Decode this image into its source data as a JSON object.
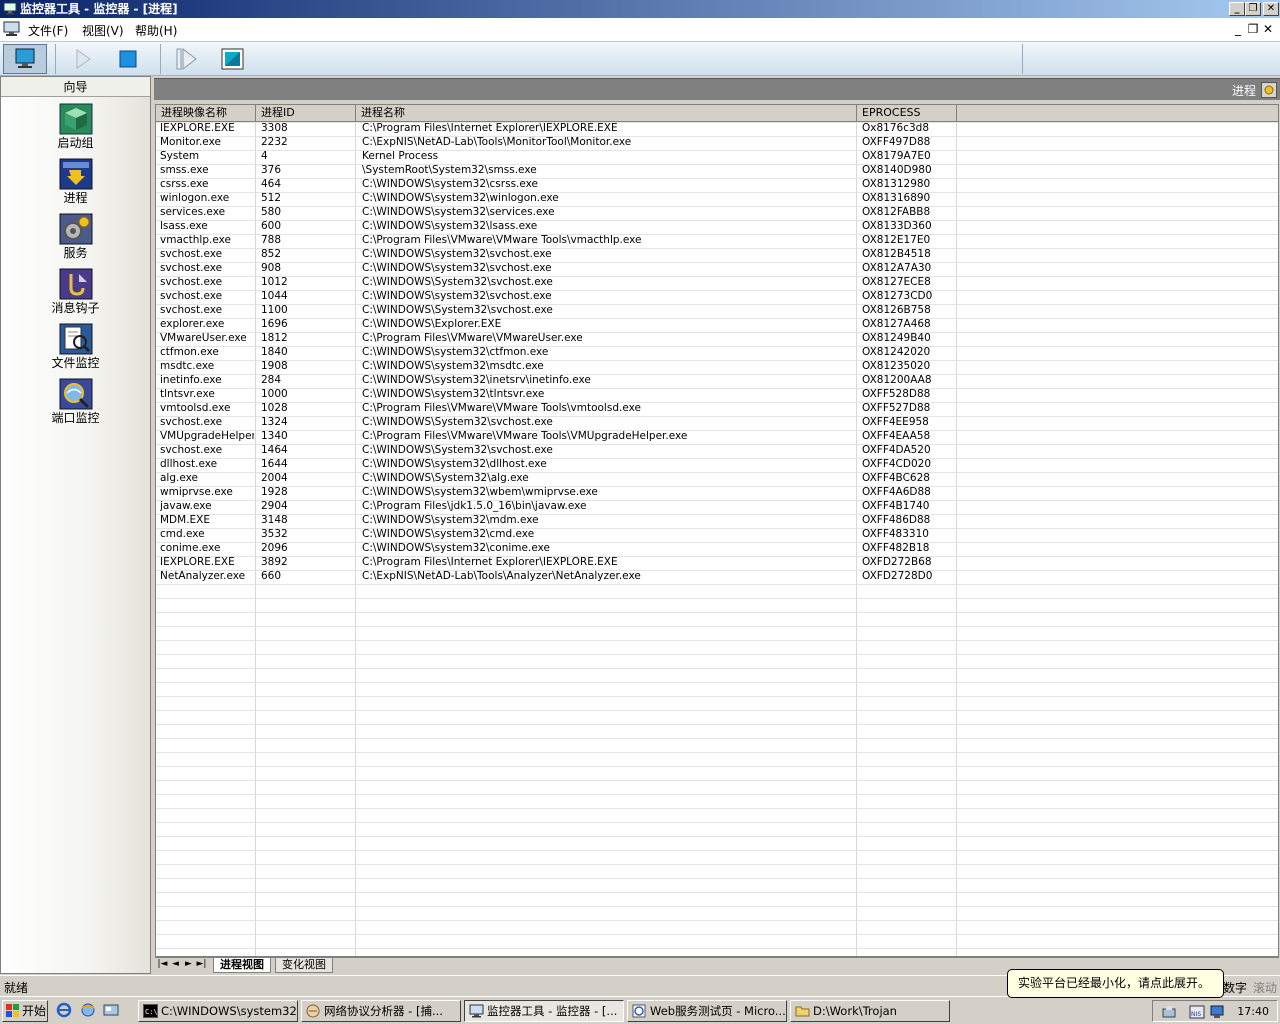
{
  "window": {
    "title": "监控器工具 - 监控器 - [进程]",
    "min": "_",
    "restore": "❐",
    "close": "✕"
  },
  "menu": {
    "items": [
      "文件(F)",
      "视图(V)",
      "帮助(H)"
    ],
    "mdi_min": "_",
    "mdi_restore": "❐",
    "mdi_close": "✕"
  },
  "sidebar": {
    "header": "向导",
    "items": [
      {
        "label": "启动组",
        "icon": "startup-group-icon"
      },
      {
        "label": "进程",
        "icon": "process-icon"
      },
      {
        "label": "服务",
        "icon": "services-icon"
      },
      {
        "label": "消息钩子",
        "icon": "message-hook-icon"
      },
      {
        "label": "文件监控",
        "icon": "file-monitor-icon"
      },
      {
        "label": "端口监控",
        "icon": "port-monitor-icon"
      }
    ]
  },
  "panel": {
    "title": "进程"
  },
  "table": {
    "columns": [
      "进程映像名称",
      "进程ID",
      "进程名称",
      "EPROCESS"
    ],
    "rows": [
      [
        "IEXPLORE.EXE",
        "3308",
        "C:\\Program Files\\Internet Explorer\\IEXPLORE.EXE",
        "Ox8176c3d8"
      ],
      [
        "Monitor.exe",
        "2232",
        "C:\\ExpNIS\\NetAD-Lab\\Tools\\MonitorTool\\Monitor.exe",
        "OXFF497D88"
      ],
      [
        "System",
        "4",
        "Kernel Process",
        "OX8179A7E0"
      ],
      [
        "smss.exe",
        "376",
        "\\SystemRoot\\System32\\smss.exe",
        "OX8140D980"
      ],
      [
        "csrss.exe",
        "464",
        "C:\\WINDOWS\\system32\\csrss.exe",
        "OX81312980"
      ],
      [
        "winlogon.exe",
        "512",
        "C:\\WINDOWS\\system32\\winlogon.exe",
        "OX81316890"
      ],
      [
        "services.exe",
        "580",
        "C:\\WINDOWS\\system32\\services.exe",
        "OX812FABB8"
      ],
      [
        "lsass.exe",
        "600",
        "C:\\WINDOWS\\system32\\lsass.exe",
        "OX8133D360"
      ],
      [
        "vmacthlp.exe",
        "788",
        "C:\\Program Files\\VMware\\VMware Tools\\vmacthlp.exe",
        "OX812E17E0"
      ],
      [
        "svchost.exe",
        "852",
        "C:\\WINDOWS\\system32\\svchost.exe",
        "OX812B4518"
      ],
      [
        "svchost.exe",
        "908",
        "C:\\WINDOWS\\system32\\svchost.exe",
        "OX812A7A30"
      ],
      [
        "svchost.exe",
        "1012",
        "C:\\WINDOWS\\System32\\svchost.exe",
        "OX8127ECE8"
      ],
      [
        "svchost.exe",
        "1044",
        "C:\\WINDOWS\\system32\\svchost.exe",
        "OX81273CD0"
      ],
      [
        "svchost.exe",
        "1100",
        "C:\\WINDOWS\\System32\\svchost.exe",
        "OX8126B758"
      ],
      [
        "explorer.exe",
        "1696",
        "C:\\WINDOWS\\Explorer.EXE",
        "OX8127A468"
      ],
      [
        "VMwareUser.exe",
        "1812",
        "C:\\Program Files\\VMware\\VMwareUser.exe",
        "OX81249B40"
      ],
      [
        "ctfmon.exe",
        "1840",
        "C:\\WINDOWS\\system32\\ctfmon.exe",
        "OX81242020"
      ],
      [
        "msdtc.exe",
        "1908",
        "C:\\WINDOWS\\system32\\msdtc.exe",
        "OX81235020"
      ],
      [
        "inetinfo.exe",
        "284",
        "C:\\WINDOWS\\system32\\inetsrv\\inetinfo.exe",
        "OX81200AA8"
      ],
      [
        "tlntsvr.exe",
        "1000",
        "C:\\WINDOWS\\system32\\tlntsvr.exe",
        "OXFF528D88"
      ],
      [
        "vmtoolsd.exe",
        "1028",
        "C:\\Program Files\\VMware\\VMware Tools\\vmtoolsd.exe",
        "OXFF527D88"
      ],
      [
        "svchost.exe",
        "1324",
        "C:\\WINDOWS\\System32\\svchost.exe",
        "OXFF4EE958"
      ],
      [
        "VMUpgradeHelper",
        "1340",
        "C:\\Program Files\\VMware\\VMware Tools\\VMUpgradeHelper.exe",
        "OXFF4EAA58"
      ],
      [
        "svchost.exe",
        "1464",
        "C:\\WINDOWS\\System32\\svchost.exe",
        "OXFF4DA520"
      ],
      [
        "dllhost.exe",
        "1644",
        "C:\\WINDOWS\\system32\\dllhost.exe",
        "OXFF4CD020"
      ],
      [
        "alg.exe",
        "2004",
        "C:\\WINDOWS\\System32\\alg.exe",
        "OXFF4BC628"
      ],
      [
        "wmiprvse.exe",
        "1928",
        "C:\\WINDOWS\\system32\\wbem\\wmiprvse.exe",
        "OXFF4A6D88"
      ],
      [
        "javaw.exe",
        "2904",
        "C:\\Program Files\\jdk1.5.0_16\\bin\\javaw.exe",
        "OXFF4B1740"
      ],
      [
        "MDM.EXE",
        "3148",
        "C:\\WINDOWS\\system32\\mdm.exe",
        "OXFF486D88"
      ],
      [
        "cmd.exe",
        "3532",
        "C:\\WINDOWS\\system32\\cmd.exe",
        "OXFF483310"
      ],
      [
        "conime.exe",
        "2096",
        "C:\\WINDOWS\\system32\\conime.exe",
        "OXFF482B18"
      ],
      [
        "IEXPLORE.EXE",
        "3892",
        "C:\\Program Files\\Internet Explorer\\IEXPLORE.EXE",
        "OXFD272B68"
      ],
      [
        "NetAnalyzer.exe",
        "660",
        "C:\\ExpNIS\\NetAD-Lab\\Tools\\Analyzer\\NetAnalyzer.exe",
        "OXFD2728D0"
      ]
    ]
  },
  "sheet_tabs": {
    "arrows": [
      "|◄",
      "◄",
      "►",
      "►|"
    ],
    "tabs": [
      "进程视图",
      "变化视图"
    ]
  },
  "status": {
    "text": "就绪",
    "num": "数字",
    "scroll": "滚动"
  },
  "balloon": {
    "text": "实验平台已经最小化，请点此展开。"
  },
  "taskbar": {
    "start": "开始",
    "tasks": [
      "C:\\WINDOWS\\system32...",
      "网络协议分析器 - [捕...",
      "监控器工具 - 监控器 - [...",
      "Web服务测试页 - Micro...",
      "D:\\Work\\Trojan"
    ],
    "clock": "17:40"
  },
  "colors": {
    "title_start": "#0a246a",
    "title_end": "#a6caf0",
    "face": "#d4d0c8",
    "balloon": "#ffffe1"
  }
}
